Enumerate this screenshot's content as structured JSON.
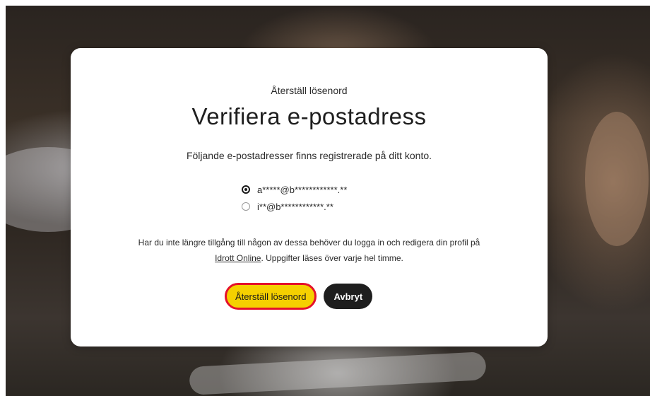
{
  "modal": {
    "eyebrow": "Återställ lösenord",
    "title": "Verifiera e-postadress",
    "subtitle": "Följande e-postadresser finns registrerade på ditt konto.",
    "emails": [
      {
        "label": "a*****@b************.**",
        "selected": true
      },
      {
        "label": "i**@b************.**",
        "selected": false
      }
    ],
    "info_before": "Har du inte längre tillgång till någon av dessa behöver du logga in och redigera din profil på",
    "info_link": "Idrott Online",
    "info_after": ". Uppgifter läses över varje hel timme.",
    "primary_button": "Återställ lösenord",
    "secondary_button": "Avbryt"
  },
  "colors": {
    "primary_button_bg": "#f5d000",
    "primary_button_outline": "#e4112b",
    "secondary_button_bg": "#1e1e1e"
  }
}
